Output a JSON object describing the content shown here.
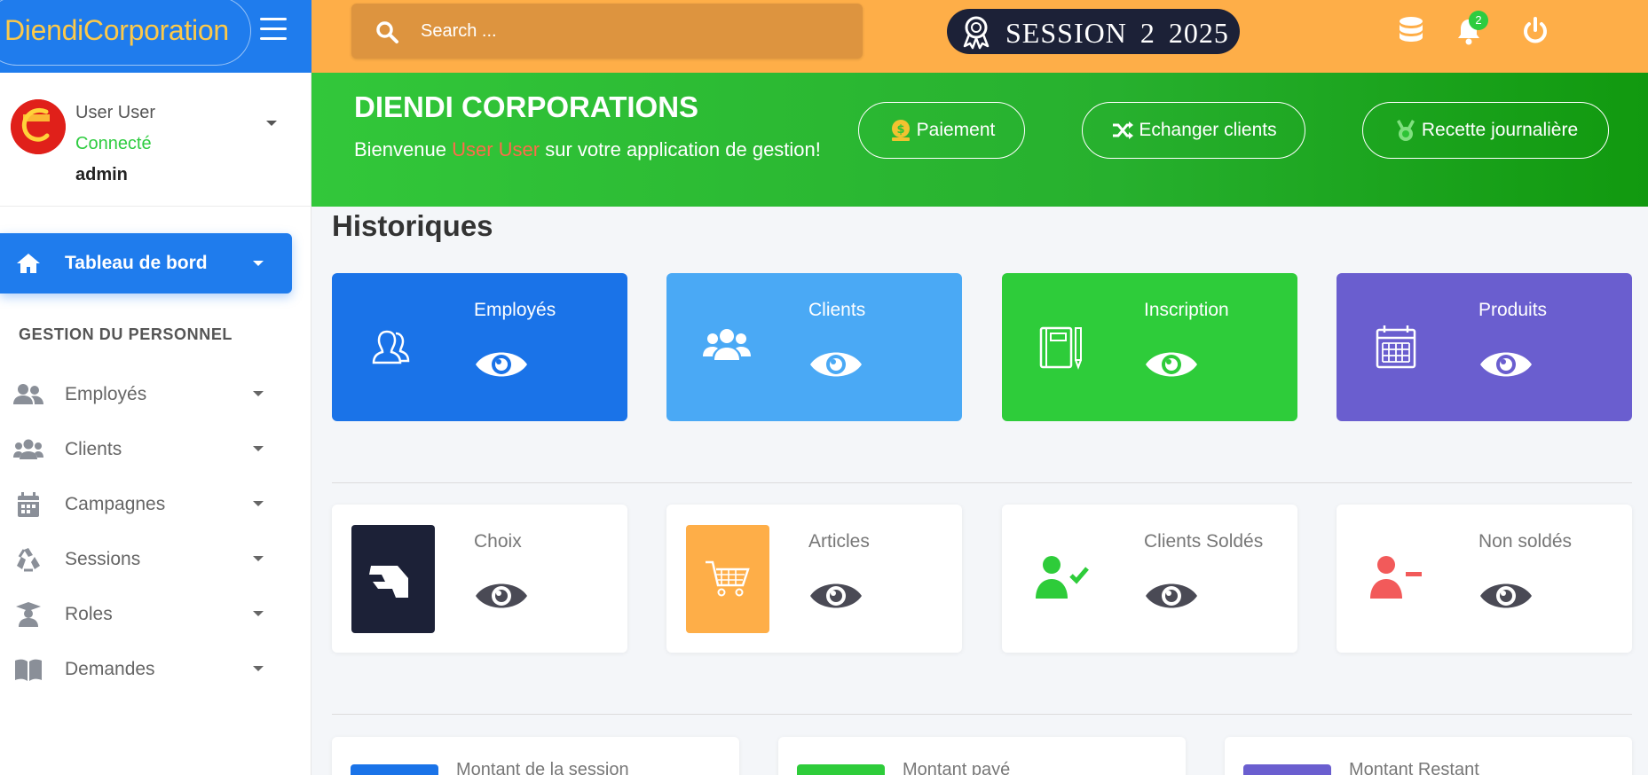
{
  "brand": {
    "name": "DiendiCorporation"
  },
  "topbar": {
    "search_placeholder": "Search ...",
    "session_label": "SESSION  2  2025",
    "notification_count": "2"
  },
  "user": {
    "name": "User User",
    "status": "Connecté",
    "role": "admin"
  },
  "sidebar": {
    "active_item": "Tableau de bord",
    "section_title": "GESTION DU PERSONNEL",
    "items": [
      {
        "label": "Employés",
        "icon": "users-icon"
      },
      {
        "label": "Clients",
        "icon": "users-group-icon"
      },
      {
        "label": "Campagnes",
        "icon": "calendar-icon"
      },
      {
        "label": "Sessions",
        "icon": "recycle-icon"
      },
      {
        "label": "Roles",
        "icon": "graduate-icon"
      },
      {
        "label": "Demandes",
        "icon": "book-icon"
      }
    ]
  },
  "banner": {
    "title": "DIENDI CORPORATIONS",
    "welcome_prefix": "Bienvenue",
    "welcome_user": "User User",
    "welcome_suffix": "sur votre application de gestion!",
    "buttons": [
      "Paiement",
      "Echanger clients",
      "Recette journalière"
    ]
  },
  "page": {
    "heading": "Historiques"
  },
  "cards_row1": [
    {
      "title": "Employés",
      "color": "#1a73e8"
    },
    {
      "title": "Clients",
      "color": "#4aa9f5"
    },
    {
      "title": "Inscription",
      "color": "#2ecc3a"
    },
    {
      "title": "Produits",
      "color": "#6a5ecf"
    }
  ],
  "cards_row2": [
    {
      "title": "Choix",
      "box_color": "#1c2137"
    },
    {
      "title": "Articles",
      "box_color": "#feae48"
    },
    {
      "title": "Clients Soldés",
      "icon_color": "#2ecc3a"
    },
    {
      "title": "Non soldés",
      "icon_color": "#f25a5a"
    }
  ],
  "cards_row3": [
    {
      "title": "Montant de la session",
      "color": "#1a73e8"
    },
    {
      "title": "Montant payé",
      "color": "#2ecc3a"
    },
    {
      "title": "Montant Restant",
      "color": "#6a5ecf"
    }
  ],
  "colors": {
    "brand": "#1f7ced",
    "topbar": "#feae48",
    "banner": "#2ec336"
  }
}
